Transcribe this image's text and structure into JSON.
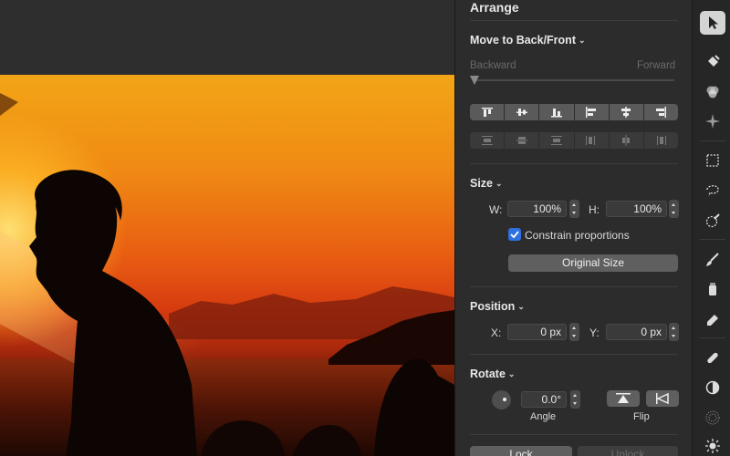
{
  "inspector": {
    "title": "Arrange",
    "move_to": {
      "label": "Move to Back/Front",
      "backward": "Backward",
      "forward": "Forward"
    },
    "size": {
      "title": "Size",
      "w_label": "W:",
      "w_value": "100%",
      "h_label": "H:",
      "h_value": "100%",
      "constrain_label": "Constrain proportions",
      "constrain_checked": true,
      "original_size_label": "Original Size"
    },
    "position": {
      "title": "Position",
      "x_label": "X:",
      "x_value": "0 px",
      "y_label": "Y:",
      "y_value": "0 px"
    },
    "rotate": {
      "title": "Rotate",
      "angle_value": "0.0°",
      "angle_label": "Angle",
      "flip_label": "Flip"
    },
    "lock_label": "Lock",
    "unlock_label": "Unlock"
  },
  "tools": [
    "arrow-select-icon",
    "paint-bucket-icon",
    "color-adjust-icon",
    "sparkle-effects-icon",
    "rect-select-icon",
    "lasso-select-icon",
    "quick-select-icon",
    "brush-icon",
    "fill-icon",
    "eraser-icon",
    "bandage-icon",
    "clone-icon",
    "blur-icon",
    "light-icon"
  ],
  "colors": {
    "panel_bg": "#2c2c2c",
    "accent_check": "#2f6fe0"
  }
}
